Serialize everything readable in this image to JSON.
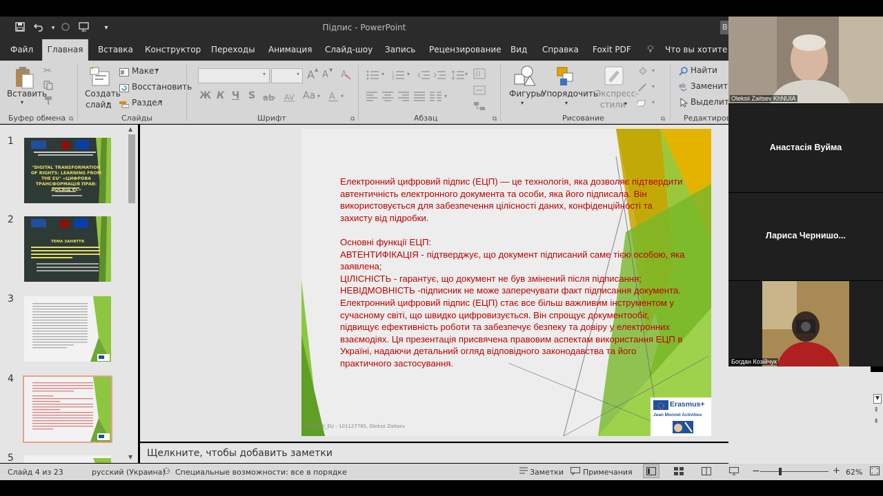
{
  "window": {
    "title": "Підпис  -  PowerPoint",
    "signin_label": "В"
  },
  "tabs": [
    {
      "label": "Файл"
    },
    {
      "label": "Главная",
      "active": true
    },
    {
      "label": "Вставка"
    },
    {
      "label": "Конструктор"
    },
    {
      "label": "Переходы"
    },
    {
      "label": "Анимация"
    },
    {
      "label": "Слайд-шоу"
    },
    {
      "label": "Запись"
    },
    {
      "label": "Рецензирование"
    },
    {
      "label": "Вид"
    },
    {
      "label": "Справка"
    },
    {
      "label": "Foxit PDF"
    }
  ],
  "tell_me": "Что вы хотите сд",
  "ribbon": {
    "clipboard": {
      "paste": "Вставить",
      "group": "Буфер обмена"
    },
    "slides": {
      "new_slide_1": "Создать",
      "new_slide_2": "слайд",
      "layout": "Макет",
      "reset": "Восстановить",
      "section": "Раздел",
      "group": "Слайды"
    },
    "font": {
      "group": "Шрифт",
      "bold": "Ж",
      "italic": "К",
      "underline": "Ч",
      "strike": "S",
      "grow": "A",
      "shrink": "A",
      "case": "Aa"
    },
    "paragraph": {
      "group": "Абзац"
    },
    "drawing": {
      "shapes": "Фигуры",
      "arrange": "Упорядочить",
      "quick_styles_1": "Экспресс-",
      "quick_styles_2": "стили",
      "group": "Рисование"
    },
    "editing": {
      "find": "Найти",
      "replace": "Заменить",
      "select": "Выделить",
      "group": "Редактирован"
    }
  },
  "thumbnails": [
    {
      "num": "1",
      "title": "\"DIGITAL TRANSFORMATION OF RIGHTS: LEARNING FROM THE EU\" «ЦИФРОВА ТРАНСФОРМАЦІЯ ПРАВ: ДОСВІД ЄС»"
    },
    {
      "num": "2",
      "title": "ТЕМА ЗАНЯТТЯ"
    },
    {
      "num": "3"
    },
    {
      "num": "4"
    },
    {
      "num": "5"
    }
  ],
  "slide": {
    "para1": "Електронний цифровий підпис (ЕЦП) — це технологія, яка дозволяє підтвердити автентичність електронного документа та особи, яка його підписала. Він використовується для забезпечення цілісності даних, конфіденційності та захисту від підробки.",
    "heading": "Основні функції ЕЦП:",
    "item1": "АВТЕНТИФІКАЦІЯ - підтверджує, що документ підписаний саме тією особою, яка заявлена;",
    "item2": "ЦІЛІСНІСТЬ - гарантує, що документ не був змінений після підписання;",
    "item3": "НЕВІДМОВНІСТЬ -підписник не може заперечувати факт підписання документа.",
    "para2": "Електронний цифровий підпис (ЕЦП) стає все більш важливим інструментом у сучасному світі, що швидко цифровизується. Він спрощує документообіг, підвищує ефективність роботи та забезпечує безпеку та довіру у електронних взаємодіях. Ця презентація присвячена правовим аспектам використання ЕЦП в Україні, надаючи детальний огляд відповідного законодавства та його практичного застосування.",
    "footer": "DITRABI_EU - 101127785, Oleksii Zaitsev",
    "logo_1": "Erasmus+",
    "logo_2": "Jean Monnet Activities"
  },
  "notes_placeholder": "Щелкните, чтобы добавить заметки",
  "status": {
    "slide_of": "Слайд 4 из 23",
    "language": "русский (Украина)",
    "accessibility": "Специальные возможности: все в порядке",
    "notes": "Заметки",
    "comments": "Примечания",
    "zoom": "62%",
    "zoom_level": 0.62
  },
  "participants": [
    {
      "name": "Oleksii Zaitsev KhNUIA",
      "video": true
    },
    {
      "name": "Анастасія Вуйма",
      "video": false
    },
    {
      "name": "Лариса  Чернишо...",
      "video": false
    },
    {
      "name": "Богдан Козійчук",
      "video": true
    }
  ],
  "colors": {
    "accent": "#c43e1c",
    "slide_text": "#c00000",
    "green": "#8dc63f"
  }
}
